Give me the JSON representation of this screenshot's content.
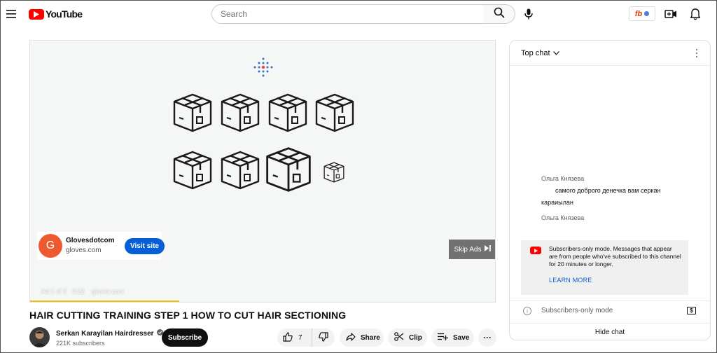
{
  "masthead": {
    "logo_text": "YouTube",
    "search_placeholder": "Search",
    "notification_badge": "fb"
  },
  "player": {
    "ad": {
      "advertiser_initial": "G",
      "advertiser_name": "Glovesdotcom",
      "advertiser_domain": "gloves.com",
      "visit_label": "Visit site",
      "skip_label": "Skip Ads",
      "ad_counter": "Ad 1 of 2 · 0:22",
      "ad_domain": "gloves.com",
      "progress_fraction": 0.32,
      "accent_color": "#f4c20d"
    }
  },
  "video": {
    "title": "HAIR CUTTING TRAINING STEP 1 HOW TO CUT HAIR SECTIONING",
    "channel_name": "Serkan Karayilan Hairdresser",
    "subscribers": "221K subscribers",
    "subscribe_label": "Subscribe",
    "like_count": "7",
    "share_label": "Share",
    "clip_label": "Clip",
    "save_label": "Save",
    "more_label": "···"
  },
  "chat": {
    "header": "Top chat",
    "messages": [
      {
        "author": "Ольга Князева",
        "text": "самого доброго денечка вам серкан караиылан"
      },
      {
        "author": "Ольга Князева",
        "text": ""
      }
    ],
    "notice_text": "Subscribers-only mode. Messages that appear are from people who've subscribed to this channel for 20 minutes or longer.",
    "learn_more": "LEARN MORE",
    "input_placeholder": "Subscribers-only mode",
    "hide_chat": "Hide chat",
    "brand_color": "#ff0000",
    "link_color": "#065fd4"
  }
}
